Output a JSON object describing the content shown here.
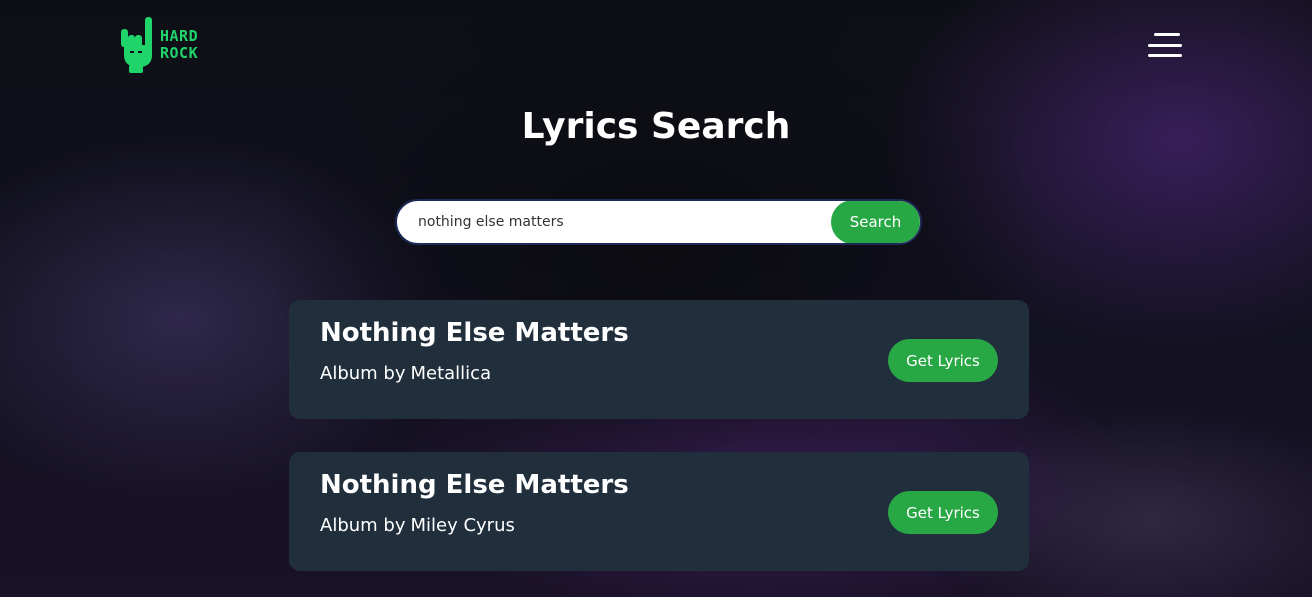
{
  "brand": {
    "logo_text_line1": "HARD",
    "logo_text_line2": "ROCK",
    "logo_icon": "rock-hand-icon",
    "accent_color": "#1fd46a"
  },
  "nav": {
    "menu_icon": "hamburger-menu-icon"
  },
  "page": {
    "title": "Lyrics Search"
  },
  "search": {
    "value": "nothing else matters",
    "button_label": "Search",
    "button_color": "#28a745"
  },
  "results": [
    {
      "title": "Nothing Else Matters",
      "artist_prefix": "Album by",
      "artist": "Metallica",
      "button_label": "Get Lyrics"
    },
    {
      "title": "Nothing Else Matters",
      "artist_prefix": "Album by",
      "artist": "Miley Cyrus",
      "button_label": "Get Lyrics"
    }
  ],
  "colors": {
    "card_background": "#212f3d",
    "page_background": "#0d0e14"
  }
}
